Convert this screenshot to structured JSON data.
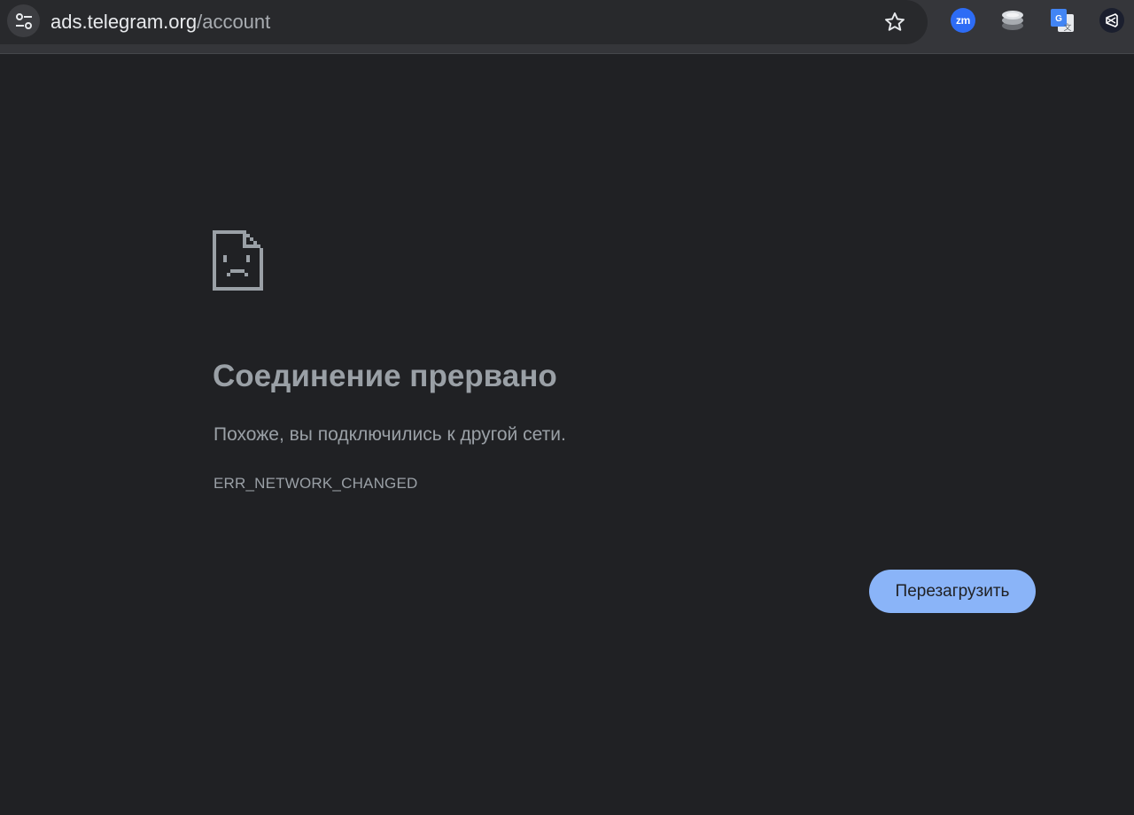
{
  "toolbar": {
    "url_host": "ads.telegram.org",
    "url_path": "/account",
    "extensions": [
      "zoom-extension",
      "layers-extension",
      "google-translate-extension",
      "visual-studio-extension"
    ],
    "zoom_label": "zm"
  },
  "error": {
    "icon": "sad-page-icon",
    "title": "Соединение прервано",
    "description": "Похоже, вы подключились к другой сети.",
    "code": "ERR_NETWORK_CHANGED",
    "reload_label": "Перезагрузить"
  },
  "colors": {
    "page_background": "#202124",
    "toolbar_background": "#35363a",
    "text_secondary": "#9aa0a6",
    "button_accent": "#8ab4f8"
  }
}
